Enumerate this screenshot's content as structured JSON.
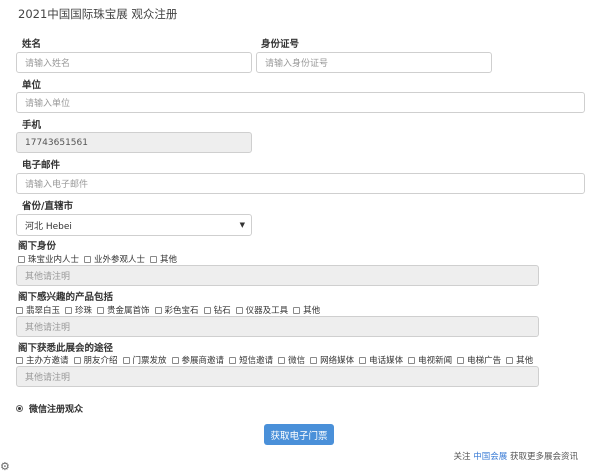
{
  "title": "2021中国国际珠宝展 观众注册",
  "fields": {
    "name": {
      "label": "姓名",
      "placeholder": "请输入姓名"
    },
    "id_card": {
      "label": "身份证号",
      "placeholder": "请输入身份证号"
    },
    "company": {
      "label": "单位",
      "placeholder": "请输入单位"
    },
    "phone": {
      "label": "手机",
      "value": "17743651561"
    },
    "email": {
      "label": "电子邮件",
      "placeholder": "请输入电子邮件"
    },
    "province": {
      "label": "省份/直辖市",
      "value": "河北 Hebei"
    }
  },
  "identity": {
    "label": "阁下身份",
    "options": [
      "珠宝业内人士",
      "业外参观人士",
      "其他"
    ],
    "other_placeholder": "其他请注明"
  },
  "interest": {
    "label": "阁下感兴趣的产品包括",
    "options": [
      "翡翠白玉",
      "珍珠",
      "贵金属首饰",
      "彩色宝石",
      "钻石",
      "仪器及工具",
      "其他"
    ],
    "other_placeholder": "其他请注明"
  },
  "channel": {
    "label": "阁下获悉此展会的途径",
    "options": [
      "主办方邀请",
      "朋友介绍",
      "门票发放",
      "参展商邀请",
      "短信邀请",
      "微信",
      "网络媒体",
      "电话媒体",
      "电视新闻",
      "电梯广告",
      "其他"
    ],
    "other_placeholder": "其他请注明"
  },
  "wechat_register": "微信注册观众",
  "submit_label": "获取电子门票",
  "footer": {
    "prefix": "关注",
    "link": "中国会展",
    "suffix": "获取更多展会资讯"
  },
  "icons": {
    "settings": "gear-icon"
  }
}
